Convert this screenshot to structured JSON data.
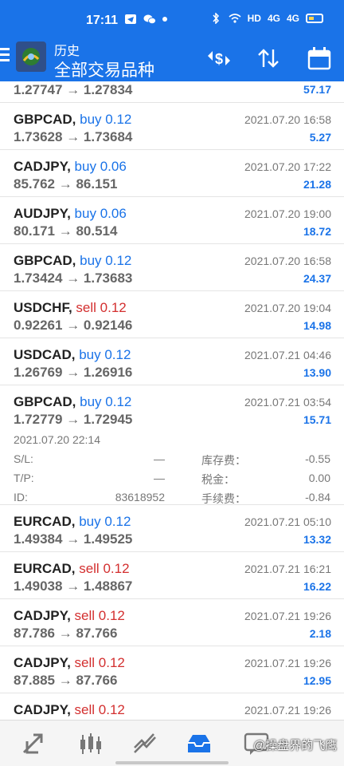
{
  "status_bar": {
    "time": "17:11",
    "network": "HD",
    "signal1": "4G",
    "signal2": "4G"
  },
  "header": {
    "subtitle": "历史",
    "title": "全部交易品种"
  },
  "trades": [
    {
      "symbol": "",
      "direction": "",
      "lots": "",
      "open_price": "1.27747",
      "close_price": "1.27834",
      "time": "",
      "profit": "57.17"
    },
    {
      "symbol": "GBPCAD,",
      "direction": "buy",
      "lots": "0.12",
      "open_price": "1.73628",
      "close_price": "1.73684",
      "time": "2021.07.20 16:58",
      "profit": "5.27"
    },
    {
      "symbol": "CADJPY,",
      "direction": "buy",
      "lots": "0.06",
      "open_price": "85.762",
      "close_price": "86.151",
      "time": "2021.07.20 17:22",
      "profit": "21.28"
    },
    {
      "symbol": "AUDJPY,",
      "direction": "buy",
      "lots": "0.06",
      "open_price": "80.171",
      "close_price": "80.514",
      "time": "2021.07.20 19:00",
      "profit": "18.72"
    },
    {
      "symbol": "GBPCAD,",
      "direction": "buy",
      "lots": "0.12",
      "open_price": "1.73424",
      "close_price": "1.73683",
      "time": "2021.07.20 16:58",
      "profit": "24.37"
    },
    {
      "symbol": "USDCHF,",
      "direction": "sell",
      "lots": "0.12",
      "open_price": "0.92261",
      "close_price": "0.92146",
      "time": "2021.07.20 19:04",
      "profit": "14.98"
    },
    {
      "symbol": "USDCAD,",
      "direction": "buy",
      "lots": "0.12",
      "open_price": "1.26769",
      "close_price": "1.26916",
      "time": "2021.07.21 04:46",
      "profit": "13.90"
    },
    {
      "symbol": "GBPCAD,",
      "direction": "buy",
      "lots": "0.12",
      "open_price": "1.72779",
      "close_price": "1.72945",
      "time": "2021.07.21 03:54",
      "profit": "15.71"
    },
    {
      "symbol": "EURCAD,",
      "direction": "buy",
      "lots": "0.12",
      "open_price": "1.49384",
      "close_price": "1.49525",
      "time": "2021.07.21 05:10",
      "profit": "13.32"
    },
    {
      "symbol": "EURCAD,",
      "direction": "sell",
      "lots": "0.12",
      "open_price": "1.49038",
      "close_price": "1.48867",
      "time": "2021.07.21 16:21",
      "profit": "16.22"
    },
    {
      "symbol": "CADJPY,",
      "direction": "sell",
      "lots": "0.12",
      "open_price": "87.786",
      "close_price": "87.766",
      "time": "2021.07.21 19:26",
      "profit": "2.18"
    },
    {
      "symbol": "CADJPY,",
      "direction": "sell",
      "lots": "0.12",
      "open_price": "87.885",
      "close_price": "87.766",
      "time": "2021.07.21 19:26",
      "profit": "12.95"
    },
    {
      "symbol": "CADJPY,",
      "direction": "sell",
      "lots": "0.12",
      "open_price": "",
      "close_price": "",
      "time": "2021.07.21 19:26",
      "profit": ""
    }
  ],
  "arrow": "→",
  "expanded": {
    "open_time": "2021.07.20 22:14",
    "sl_label": "S/L:",
    "sl_value": "—",
    "tp_label": "T/P:",
    "tp_value": "—",
    "id_label": "ID:",
    "id_value": "83618952",
    "swap_label": "库存费：",
    "swap_value": "-0.55",
    "tax_label": "税金：",
    "tax_value": "0.00",
    "commission_label": "手续费：",
    "commission_value": "-0.84"
  },
  "watermark": "@操盘界的飞鹰",
  "colors": {
    "accent": "#1a73e8",
    "buy": "#1a73e8",
    "sell": "#d32f2f",
    "profit": "#1a73e8"
  },
  "nav_icons": [
    "quotes-icon",
    "chart-icon",
    "trade-icon",
    "history-icon",
    "messages-icon"
  ]
}
